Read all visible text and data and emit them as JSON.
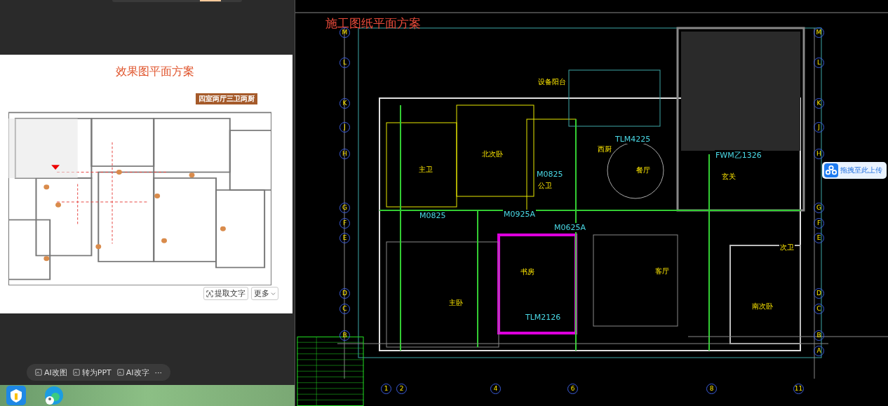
{
  "left_viewer": {
    "title": "效果图平面方案",
    "badge": "四室两厅三卫两厨",
    "buttons": [
      {
        "label": "提取文字",
        "kind": "ocr"
      },
      {
        "label": "更多",
        "kind": "more"
      }
    ]
  },
  "ai_toolbar": [
    {
      "label": "AI改图",
      "kind": "edit"
    },
    {
      "label": "转为PPT",
      "kind": "ppt"
    },
    {
      "label": "AI改字",
      "kind": "text"
    },
    {
      "label": "···",
      "kind": "more"
    }
  ],
  "cad_view": {
    "title": "施工图纸平面方案",
    "rooms": [
      "设备阳台",
      "北次卧",
      "主卫",
      "公卫",
      "西厨",
      "餐厅",
      "玄关",
      "书房",
      "客厅",
      "主卧",
      "南次卧",
      "次卫"
    ],
    "door_tags": [
      "TLM4225",
      "M0825",
      "M0825",
      "M0925A",
      "M0625A",
      "TLM2126",
      "FWM乙1326"
    ],
    "left_axis": [
      "M",
      "L",
      "K",
      "J",
      "H",
      "G",
      "F",
      "E",
      "D",
      "C",
      "B"
    ],
    "right_axis": [
      "M",
      "L",
      "K",
      "J",
      "H",
      "G",
      "F",
      "E",
      "D",
      "C",
      "B",
      "A"
    ],
    "bottom_axis": [
      "1",
      "2",
      "4",
      "6",
      "8",
      "11"
    ]
  },
  "upload_button": {
    "label": "拖拽至此上传"
  }
}
